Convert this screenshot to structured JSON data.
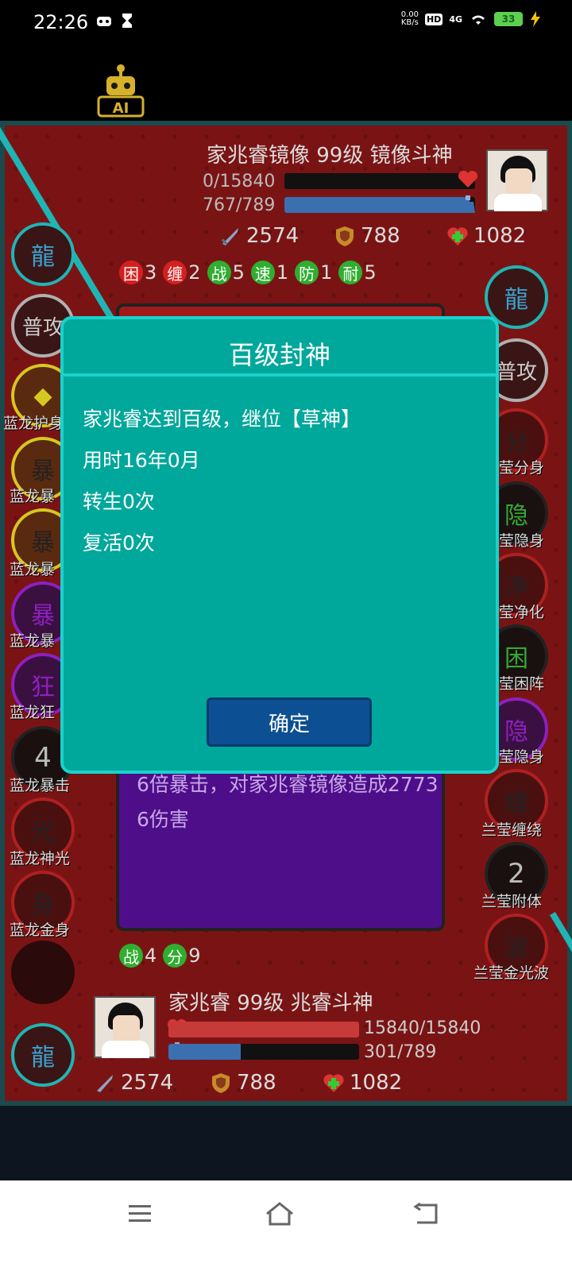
{
  "status_bar": {
    "time": "22:26",
    "net_speed_value": "0.00",
    "net_speed_unit": "KB/s",
    "hd": "HD",
    "network": "4G",
    "battery": "33"
  },
  "ai_badge": "AI",
  "enemy": {
    "name_line": "家兆睿镜像 99级 镜像斗神",
    "hp_text": "0/15840",
    "mp_text": "767/789",
    "hp_fraction": 0.0,
    "mp_fraction": 0.972,
    "attack": "2574",
    "defense": "788",
    "heal": "1082"
  },
  "enemy_status": [
    {
      "char": "困",
      "count": "3",
      "color": "red"
    },
    {
      "char": "缠",
      "count": "2",
      "color": "red"
    },
    {
      "char": "战",
      "count": "5",
      "color": "green"
    },
    {
      "char": "速",
      "count": "1",
      "color": "green"
    },
    {
      "char": "防",
      "count": "1",
      "color": "green"
    },
    {
      "char": "耐",
      "count": "5",
      "color": "green"
    }
  ],
  "left_skills": {
    "normal_attack": "普攻",
    "labels": [
      "蓝龙护身",
      "蓝龙暴",
      "蓝龙暴",
      "蓝龙暴",
      "蓝龙狂",
      "蓝龙暴击",
      "蓝龙神光",
      "蓝龙金身"
    ],
    "cooldown_crit": "4"
  },
  "right_skills": {
    "normal_attack": "普攻",
    "labels": [
      "莹分身",
      "莹隐身",
      "莹净化",
      "莹困阵",
      "莹隐身",
      "兰莹缠绕",
      "兰莹附体",
      "兰莹金光波"
    ],
    "cooldown_attach": "2"
  },
  "battle_log": "6倍暴击，对家兆睿镜像造成27736伤害",
  "player_status": [
    {
      "char": "战",
      "count": "4",
      "color": "green"
    },
    {
      "char": "分",
      "count": "9",
      "color": "green"
    }
  ],
  "player": {
    "name_line": "家兆睿 99级 兆睿斗神",
    "hp_text": "15840/15840",
    "mp_text": "301/789",
    "hp_fraction": 1.0,
    "mp_fraction": 0.381,
    "attack": "2574",
    "defense": "788",
    "heal": "1082"
  },
  "dialog": {
    "title": "百级封神",
    "line1": "家兆睿达到百级，继位【草神】",
    "line2": "用时16年0月",
    "line3": "转生0次",
    "line4": "复活0次",
    "confirm": "确定"
  },
  "colors": {
    "dialog_bg": "#00a79b",
    "dialog_border": "#19d3cc",
    "button_bg": "#0d4f93",
    "hp_red": "#c83a3a",
    "mp_blue": "#3a6fb0"
  }
}
